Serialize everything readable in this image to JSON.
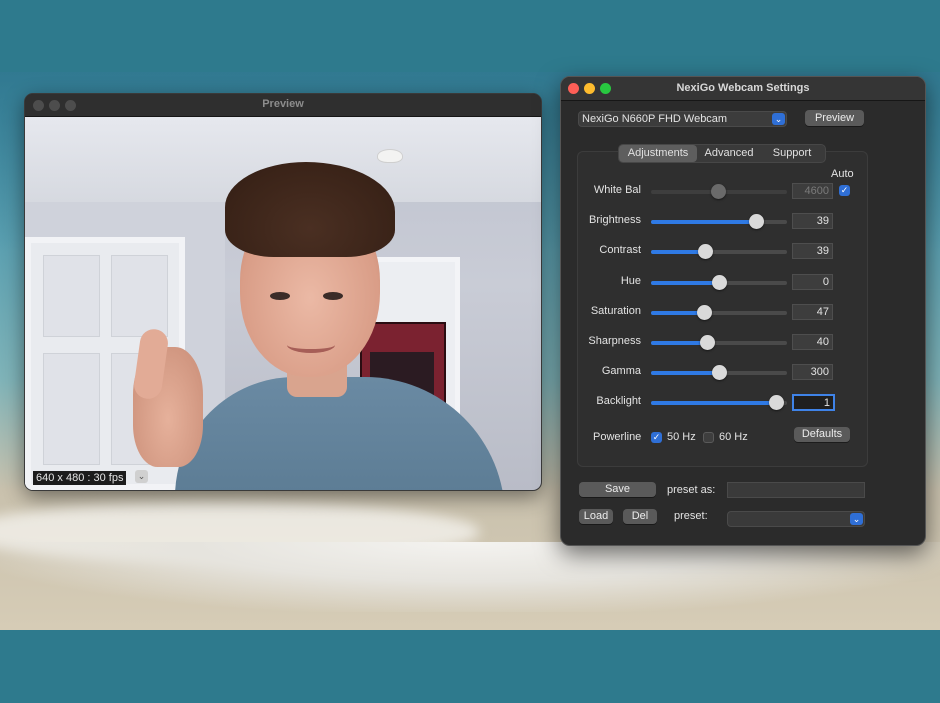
{
  "preview_window": {
    "title": "Preview",
    "resolution_label": "640 x 480 : 30 fps"
  },
  "settings_window": {
    "title": "NexiGo Webcam Settings",
    "device": "NexiGo N660P FHD Webcam",
    "preview_button": "Preview",
    "tabs": [
      {
        "label": "Adjustments",
        "selected": true
      },
      {
        "label": "Advanced",
        "selected": false
      },
      {
        "label": "Support",
        "selected": false
      }
    ],
    "auto_label": "Auto",
    "controls": [
      {
        "label": "White Bal",
        "value": "4600",
        "level": 0.49,
        "enabled": false,
        "auto": true
      },
      {
        "label": "Brightness",
        "value": "39",
        "level": 0.77,
        "enabled": true
      },
      {
        "label": "Contrast",
        "value": "39",
        "level": 0.4,
        "enabled": true
      },
      {
        "label": "Hue",
        "value": "0",
        "level": 0.5,
        "enabled": true
      },
      {
        "label": "Saturation",
        "value": "47",
        "level": 0.39,
        "enabled": true
      },
      {
        "label": "Sharpness",
        "value": "40",
        "level": 0.41,
        "enabled": true
      },
      {
        "label": "Gamma",
        "value": "300",
        "level": 0.5,
        "enabled": true
      },
      {
        "label": "Backlight",
        "value": "1",
        "level": 0.92,
        "enabled": true,
        "focused": true
      }
    ],
    "powerline": {
      "label": "Powerline",
      "option_50": "50 Hz",
      "option_50_checked": true,
      "option_60": "60 Hz",
      "option_60_checked": false
    },
    "defaults_button": "Defaults",
    "save_button": "Save",
    "preset_as_label": "preset as:",
    "load_button": "Load",
    "del_button": "Del",
    "preset_label": "preset:",
    "accent_color": "#2f7ae5"
  }
}
